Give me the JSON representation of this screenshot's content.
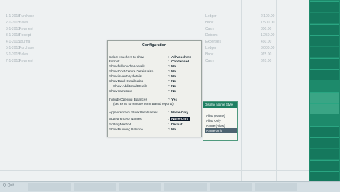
{
  "background_ledger": {
    "rows": [
      [
        "1-1-2018",
        "Purchase",
        "",
        "Ledger",
        "2,100.00"
      ],
      [
        "2-1-2018",
        "Sales",
        "",
        "Bank",
        "1,500.00"
      ],
      [
        "3-1-2018",
        "Payment",
        "",
        "Cash",
        "800.00"
      ],
      [
        "3-1-2018",
        "Receipt",
        "",
        "Debtors",
        "1,250.00"
      ],
      [
        "4-1-2018",
        "Journal",
        "",
        "Expenses",
        "450.00"
      ],
      [
        "5-1-2018",
        "Purchase",
        "",
        "Ledger",
        "3,000.00"
      ],
      [
        "6-1-2018",
        "Sales",
        "",
        "Bank",
        "975.00"
      ],
      [
        "7-1-2018",
        "Payment",
        "",
        "Cash",
        "620.00"
      ]
    ]
  },
  "config_dialog": {
    "title": "Configuration",
    "rows": [
      {
        "label": "Select vouchers to show",
        "colon": ":",
        "value": "All Vouchers"
      },
      {
        "label": "Format",
        "colon": ":",
        "value": "Condensed"
      },
      {
        "label": "Show full voucher details",
        "colon": "?",
        "value": "No"
      },
      {
        "label": "Show Cost Centre Details also",
        "colon": "?",
        "value": "No"
      },
      {
        "label": "Show inventory details",
        "colon": "?",
        "value": "No"
      },
      {
        "label": "Show Bank Details also",
        "colon": "?",
        "value": "No"
      },
      {
        "label": "Show Additional Details",
        "colon": "?",
        "value": "No"
      },
      {
        "label": "Show narrations",
        "colon": "?",
        "value": "No"
      },
      {
        "label": "Include Opening Balances",
        "colon": "?",
        "value": "Yes"
      },
      {
        "label": "(set as no to remove Term Based reports)",
        "colon": "",
        "value": ""
      },
      {
        "label": "Appearance of Stock Item Names",
        "colon": ":",
        "value": "Name Only"
      },
      {
        "label": "Appearance of Names",
        "colon": ":",
        "value": "Name Only"
      },
      {
        "label": "Sorting Method",
        "colon": ":",
        "value": "Default"
      },
      {
        "label": "Show Running Balance",
        "colon": "?",
        "value": "No"
      }
    ]
  },
  "display_name_popup": {
    "title": "Display Name Style",
    "options": [
      "Alias (Name)",
      "Alias Only",
      "Name (Alias)",
      "Name Only"
    ],
    "selected_index": 3
  },
  "bottom_bar": {
    "label": "Q: Quit"
  },
  "colors": {
    "panel_green": "#1d8a6b",
    "popup_header": "#1e7f62",
    "highlight": "#0e1b2a",
    "selected_option": "#4e6471"
  }
}
